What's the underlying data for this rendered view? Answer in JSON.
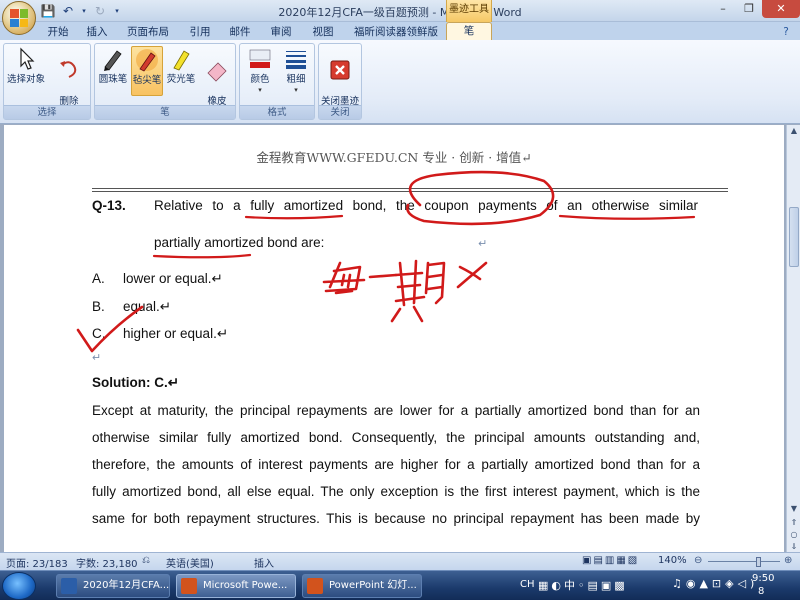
{
  "window": {
    "title": "2020年12月CFA一级百题预测 - Microsoft Word",
    "context_tab_title": "墨迹工具",
    "minimize": "–",
    "restore": "❐",
    "close": "✕"
  },
  "tabs": [
    "开始",
    "插入",
    "页面布局",
    "引用",
    "邮件",
    "审阅",
    "视图",
    "福昕阅读器领鲜版",
    "笔"
  ],
  "ribbon": {
    "groups": [
      {
        "label": "选择",
        "buttons": [
          "选择对象",
          "删除\n所有墨迹"
        ]
      },
      {
        "label": "笔",
        "buttons": [
          "圆珠笔",
          "毡尖笔",
          "荧光笔",
          "橡皮\n擦"
        ]
      },
      {
        "label": "格式",
        "buttons": [
          "颜色",
          "粗细"
        ]
      },
      {
        "label": "关闭",
        "buttons": [
          "关闭墨迹\n书写工具"
        ]
      }
    ]
  },
  "document": {
    "header": "金程教育WWW.GFEDU.CN 专业 · 创新 · 增值↵",
    "question_number": "Q-13.",
    "question_line1": "Relative to a fully amortized bond, the coupon payments of an otherwise similar",
    "question_line2": "partially amortized bond are:",
    "options": [
      {
        "letter": "A.",
        "text": "lower or equal.↵"
      },
      {
        "letter": "B.",
        "text": "equal.↵"
      },
      {
        "letter": "C.",
        "text": "higher or equal.↵"
      }
    ],
    "empty_para": "↵",
    "solution_title": "Solution: C.↵",
    "solution_lines": [
      "Except at maturity, the principal repayments are lower for a partially amortized bond than for an",
      "otherwise similar fully amortized bond. Consequently, the principal amounts outstanding and,",
      "therefore, the amounts of interest payments are higher for a partially amortized bond than for a",
      "fully amortized bond, all else equal. The only exception is the first interest payment, which is the",
      "same for both repayment structures. This is because no principal repayment has been made by"
    ],
    "handwriting": "每一期 >",
    "ink_color": "#d11a1a"
  },
  "status_bar": {
    "page": "页面: 23/183",
    "words": "字数: 23,180",
    "language": "英语(美国)",
    "insert": "插入",
    "zoom": "140%"
  },
  "taskbar": {
    "items": [
      "2020年12月CFA...",
      "Microsoft Powe...",
      "PowerPoint 幻灯..."
    ],
    "lang": "CH",
    "time": "9:50",
    "date": "8"
  }
}
